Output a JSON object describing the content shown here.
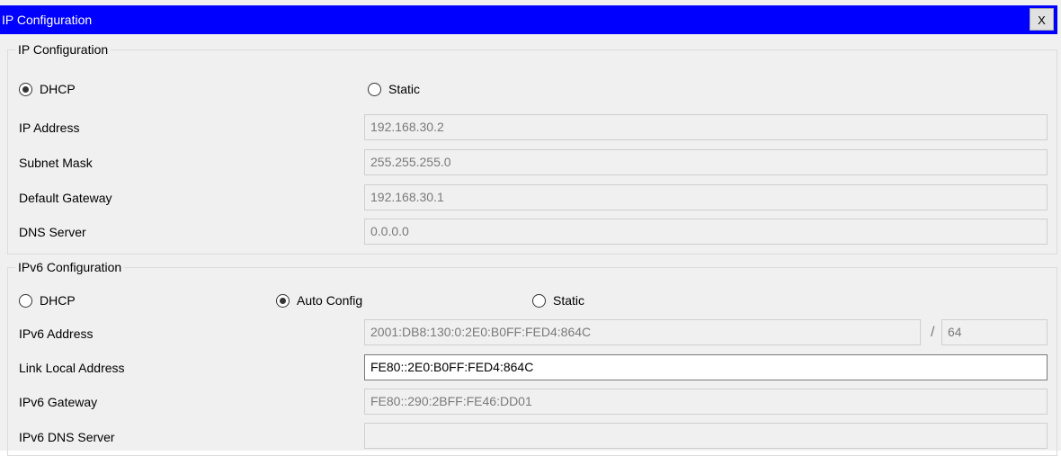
{
  "window": {
    "title": "IP Configuration",
    "close_label": "X"
  },
  "ipv4": {
    "legend": "IP Configuration",
    "dhcp_label": "DHCP",
    "static_label": "Static",
    "selected": "DHCP",
    "fields": {
      "ip_address": {
        "label": "IP Address",
        "value": "192.168.30.2"
      },
      "subnet_mask": {
        "label": "Subnet Mask",
        "value": "255.255.255.0"
      },
      "default_gateway": {
        "label": "Default Gateway",
        "value": "192.168.30.1"
      },
      "dns_server": {
        "label": "DNS Server",
        "value": "0.0.0.0"
      }
    }
  },
  "ipv6": {
    "legend": "IPv6 Configuration",
    "dhcp_label": "DHCP",
    "auto_label": "Auto Config",
    "static_label": "Static",
    "selected": "Auto Config",
    "fields": {
      "address": {
        "label": "IPv6 Address",
        "value": "2001:DB8:130:0:2E0:B0FF:FED4:864C",
        "prefix_separator": "/",
        "prefix": "64"
      },
      "link_local": {
        "label": "Link Local Address",
        "value": "FE80::2E0:B0FF:FED4:864C"
      },
      "gateway": {
        "label": "IPv6 Gateway",
        "value": "FE80::290:2BFF:FE46:DD01"
      },
      "dns_server": {
        "label": "IPv6 DNS Server",
        "value": ""
      }
    }
  }
}
